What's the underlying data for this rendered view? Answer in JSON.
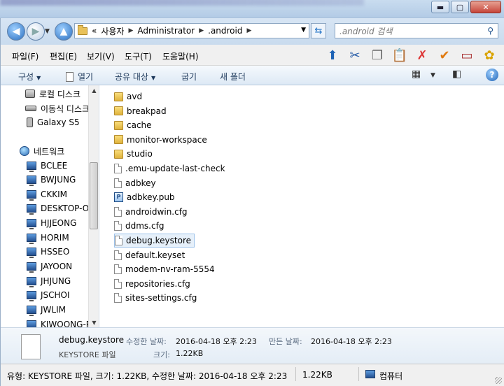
{
  "window": {
    "minimize": "▬",
    "maximize": "▢",
    "close": "✕"
  },
  "address": {
    "overflow": "«",
    "crumbs": [
      "사용자",
      "Administrator",
      ".android"
    ],
    "search_placeholder": ".android 검색"
  },
  "menu": {
    "items": [
      "파일(F)",
      "편집(E)",
      "보기(V)",
      "도구(T)",
      "도움말(H)"
    ]
  },
  "commands": {
    "organize": "구성",
    "open": "열기",
    "share": "공유 대상",
    "burn": "굽기",
    "new_folder": "새 폴더"
  },
  "nav": {
    "local_disk": "로컬 디스크",
    "removable": "이동식 디스크",
    "device": "Galaxy S5",
    "network": "네트워크",
    "computers": [
      "BCLEE",
      "BWJUNG",
      "CKKIM",
      "DESKTOP-OD",
      "HJJEONG",
      "HORIM",
      "HSSEO",
      "JAYOON",
      "JHJUNG",
      "JSCHOI",
      "JWLIM",
      "KIWOONG-P"
    ]
  },
  "files": [
    {
      "name": "avd",
      "type": "folder"
    },
    {
      "name": "breakpad",
      "type": "folder"
    },
    {
      "name": "cache",
      "type": "folder"
    },
    {
      "name": "monitor-workspace",
      "type": "folder"
    },
    {
      "name": "studio",
      "type": "folder"
    },
    {
      "name": ".emu-update-last-check",
      "type": "file"
    },
    {
      "name": "adbkey",
      "type": "file"
    },
    {
      "name": "adbkey.pub",
      "type": "pub"
    },
    {
      "name": "androidwin.cfg",
      "type": "file"
    },
    {
      "name": "ddms.cfg",
      "type": "file"
    },
    {
      "name": "debug.keystore",
      "type": "file",
      "selected": true
    },
    {
      "name": "default.keyset",
      "type": "file"
    },
    {
      "name": "modem-nv-ram-5554",
      "type": "file"
    },
    {
      "name": "repositories.cfg",
      "type": "file"
    },
    {
      "name": "sites-settings.cfg",
      "type": "file"
    }
  ],
  "details": {
    "name": "debug.keystore",
    "type": "KEYSTORE 파일",
    "modified_label": "수정한 날짜:",
    "modified_value": "2016-04-18 오후 2:23",
    "created_label": "만든 날짜:",
    "created_value": "2016-04-18 오후 2:23",
    "size_label": "크기:",
    "size_value": "1.22KB"
  },
  "status": {
    "summary": "유형: KEYSTORE 파일, 크기: 1.22KB, 수정한 날짜: 2016-04-18 오후 2:23",
    "size": "1.22KB",
    "location": "컴퓨터"
  }
}
